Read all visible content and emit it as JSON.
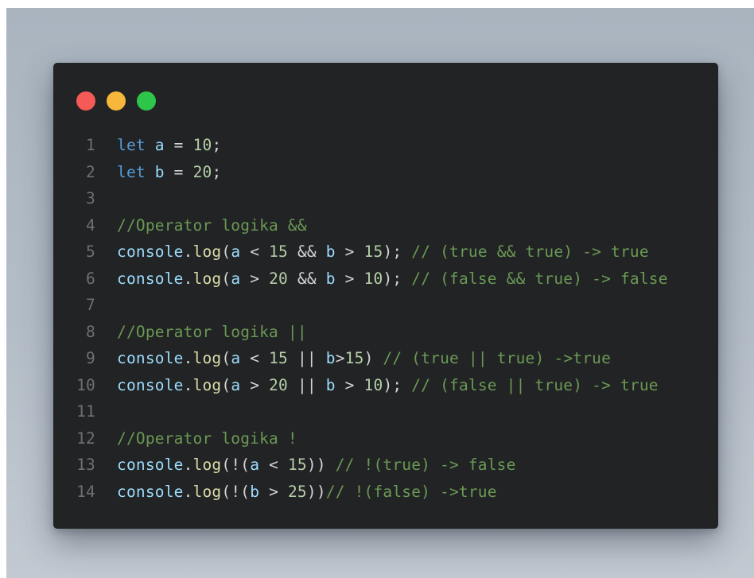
{
  "window": {
    "controls": [
      "close",
      "minimize",
      "maximize"
    ],
    "colors": {
      "close": "#f55a57",
      "minimize": "#f6b73a",
      "maximize": "#2dc64b",
      "background": "#222324"
    }
  },
  "code": {
    "lines": [
      {
        "number": "1",
        "tokens": [
          {
            "t": "let",
            "c": "kw"
          },
          {
            "t": " ",
            "c": "op"
          },
          {
            "t": "a",
            "c": "var"
          },
          {
            "t": " = ",
            "c": "op"
          },
          {
            "t": "10",
            "c": "num"
          },
          {
            "t": ";",
            "c": "op"
          }
        ]
      },
      {
        "number": "2",
        "tokens": [
          {
            "t": "let",
            "c": "kw"
          },
          {
            "t": " ",
            "c": "op"
          },
          {
            "t": "b",
            "c": "var"
          },
          {
            "t": " = ",
            "c": "op"
          },
          {
            "t": "20",
            "c": "num"
          },
          {
            "t": ";",
            "c": "op"
          }
        ]
      },
      {
        "number": "3",
        "tokens": []
      },
      {
        "number": "4",
        "tokens": [
          {
            "t": "//Operator logika &&",
            "c": "cm"
          }
        ]
      },
      {
        "number": "5",
        "tokens": [
          {
            "t": "console",
            "c": "obj"
          },
          {
            "t": ".",
            "c": "op"
          },
          {
            "t": "log",
            "c": "fn"
          },
          {
            "t": "(",
            "c": "op"
          },
          {
            "t": "a",
            "c": "var"
          },
          {
            "t": " < ",
            "c": "op"
          },
          {
            "t": "15",
            "c": "num"
          },
          {
            "t": " && ",
            "c": "op"
          },
          {
            "t": "b",
            "c": "var"
          },
          {
            "t": " > ",
            "c": "op"
          },
          {
            "t": "15",
            "c": "num"
          },
          {
            "t": "); ",
            "c": "op"
          },
          {
            "t": "// (true && true) -> true",
            "c": "cm"
          }
        ]
      },
      {
        "number": "6",
        "tokens": [
          {
            "t": "console",
            "c": "obj"
          },
          {
            "t": ".",
            "c": "op"
          },
          {
            "t": "log",
            "c": "fn"
          },
          {
            "t": "(",
            "c": "op"
          },
          {
            "t": "a",
            "c": "var"
          },
          {
            "t": " > ",
            "c": "op"
          },
          {
            "t": "20",
            "c": "num"
          },
          {
            "t": " && ",
            "c": "op"
          },
          {
            "t": "b",
            "c": "var"
          },
          {
            "t": " > ",
            "c": "op"
          },
          {
            "t": "10",
            "c": "num"
          },
          {
            "t": "); ",
            "c": "op"
          },
          {
            "t": "// (false && true) -> false",
            "c": "cm"
          }
        ]
      },
      {
        "number": "7",
        "tokens": []
      },
      {
        "number": "8",
        "tokens": [
          {
            "t": "//Operator logika ||",
            "c": "cm"
          }
        ]
      },
      {
        "number": "9",
        "tokens": [
          {
            "t": "console",
            "c": "obj"
          },
          {
            "t": ".",
            "c": "op"
          },
          {
            "t": "log",
            "c": "fn"
          },
          {
            "t": "(",
            "c": "op"
          },
          {
            "t": "a",
            "c": "var"
          },
          {
            "t": " < ",
            "c": "op"
          },
          {
            "t": "15",
            "c": "num"
          },
          {
            "t": " || ",
            "c": "op"
          },
          {
            "t": "b",
            "c": "var"
          },
          {
            "t": ">",
            "c": "op"
          },
          {
            "t": "15",
            "c": "num"
          },
          {
            "t": ") ",
            "c": "op"
          },
          {
            "t": "// (true || true) ->true",
            "c": "cm"
          }
        ]
      },
      {
        "number": "10",
        "tokens": [
          {
            "t": "console",
            "c": "obj"
          },
          {
            "t": ".",
            "c": "op"
          },
          {
            "t": "log",
            "c": "fn"
          },
          {
            "t": "(",
            "c": "op"
          },
          {
            "t": "a",
            "c": "var"
          },
          {
            "t": " > ",
            "c": "op"
          },
          {
            "t": "20",
            "c": "num"
          },
          {
            "t": " || ",
            "c": "op"
          },
          {
            "t": "b",
            "c": "var"
          },
          {
            "t": " > ",
            "c": "op"
          },
          {
            "t": "10",
            "c": "num"
          },
          {
            "t": "); ",
            "c": "op"
          },
          {
            "t": "// (false || true) -> true",
            "c": "cm"
          }
        ]
      },
      {
        "number": "11",
        "tokens": []
      },
      {
        "number": "12",
        "tokens": [
          {
            "t": "//Operator logika !",
            "c": "cm"
          }
        ]
      },
      {
        "number": "13",
        "tokens": [
          {
            "t": "console",
            "c": "obj"
          },
          {
            "t": ".",
            "c": "op"
          },
          {
            "t": "log",
            "c": "fn"
          },
          {
            "t": "(!(",
            "c": "op"
          },
          {
            "t": "a",
            "c": "var"
          },
          {
            "t": " < ",
            "c": "op"
          },
          {
            "t": "15",
            "c": "num"
          },
          {
            "t": ")) ",
            "c": "op"
          },
          {
            "t": "// !(true) -> false",
            "c": "cm"
          }
        ]
      },
      {
        "number": "14",
        "tokens": [
          {
            "t": "console",
            "c": "obj"
          },
          {
            "t": ".",
            "c": "op"
          },
          {
            "t": "log",
            "c": "fn"
          },
          {
            "t": "(!(",
            "c": "op"
          },
          {
            "t": "b",
            "c": "var"
          },
          {
            "t": " > ",
            "c": "op"
          },
          {
            "t": "25",
            "c": "num"
          },
          {
            "t": "))",
            "c": "op"
          },
          {
            "t": "// !(false) ->true",
            "c": "cm"
          }
        ]
      }
    ]
  }
}
